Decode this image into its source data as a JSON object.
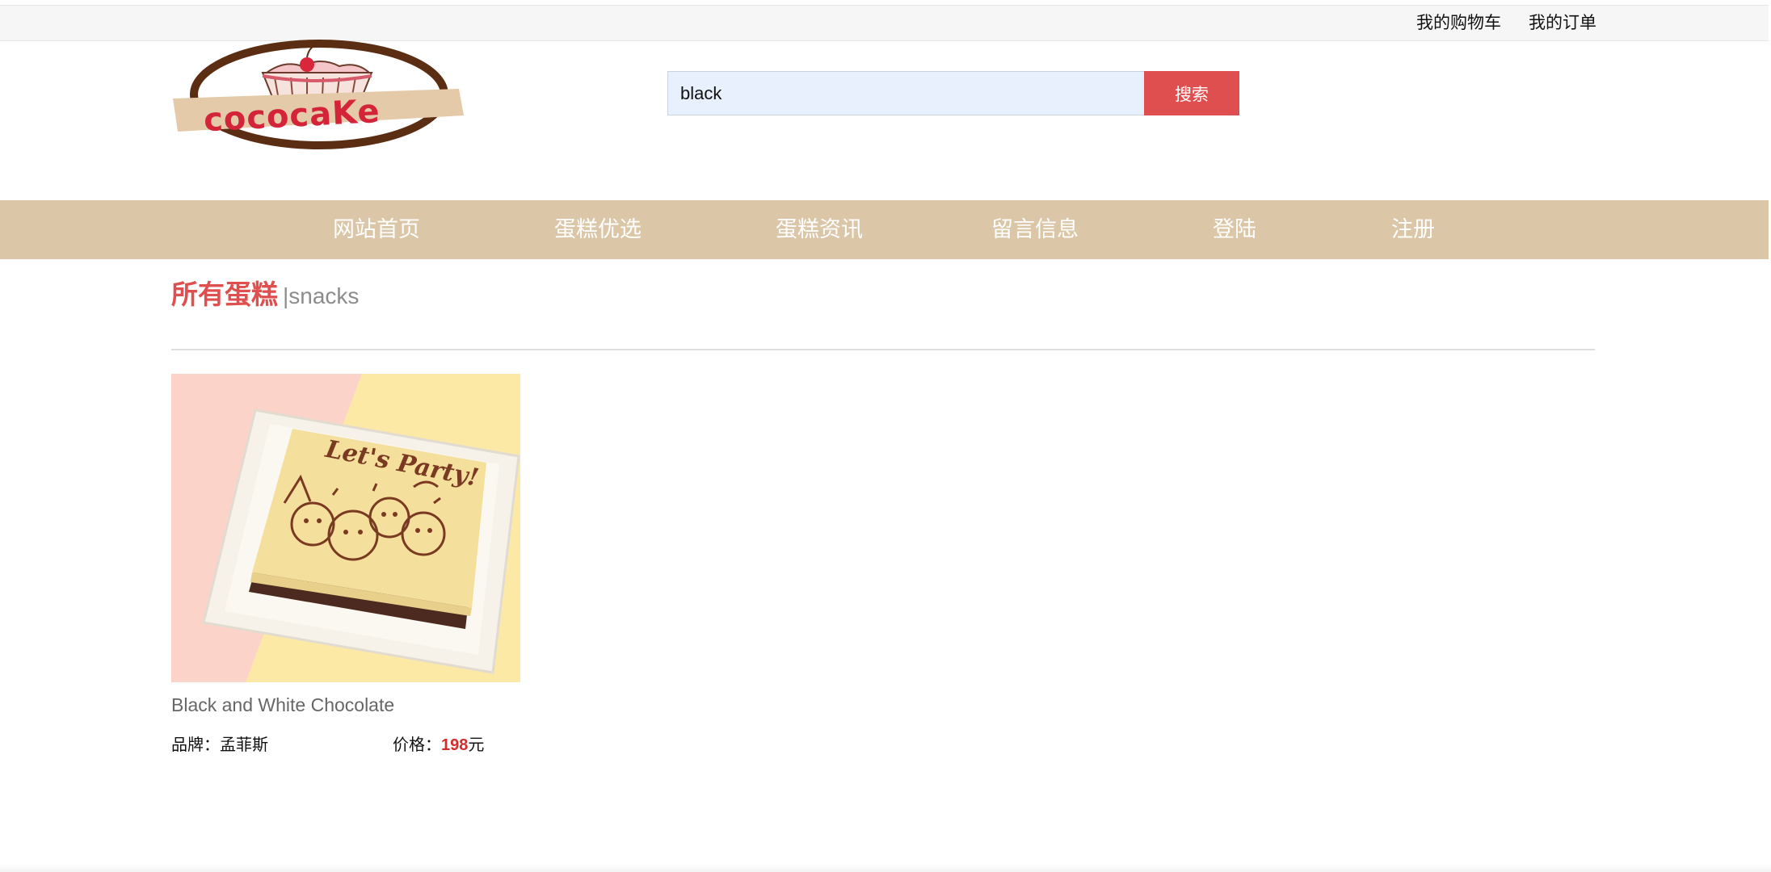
{
  "topbar": {
    "cart_label": "我的购物车",
    "orders_label": "我的订单"
  },
  "logo": {
    "text": "cococake"
  },
  "search": {
    "value": "black",
    "button_label": "搜索"
  },
  "nav": {
    "items": [
      {
        "label": "网站首页"
      },
      {
        "label": "蛋糕优选"
      },
      {
        "label": "蛋糕资讯"
      },
      {
        "label": "留言信息"
      },
      {
        "label": "登陆"
      },
      {
        "label": "注册"
      }
    ]
  },
  "section": {
    "title": "所有蛋糕",
    "subtitle": "|snacks"
  },
  "products": [
    {
      "image_text": "Let's Party!",
      "name": "Black and White Chocolate",
      "brand_label": "品牌：",
      "brand": "孟菲斯",
      "price_label": "价格：",
      "price": "198",
      "currency": "元"
    }
  ],
  "colors": {
    "accent": "#e04f4f",
    "nav_background": "#dbc7a7",
    "search_background": "#e8f0fe",
    "price": "#d42b2b"
  }
}
